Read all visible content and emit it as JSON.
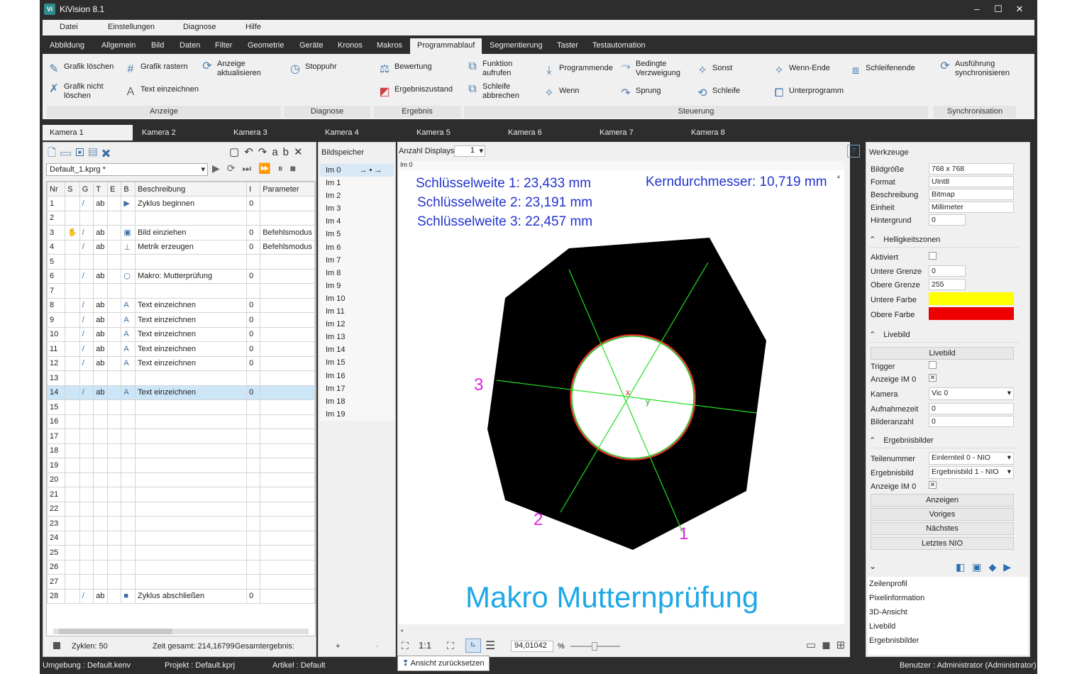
{
  "app": {
    "title": "KiVision  8.1",
    "logo": "Vi",
    "min": "–",
    "max": "☐",
    "close": "✕"
  },
  "menu": [
    "Datei",
    "Einstellungen",
    "Diagnose",
    "Hilfe"
  ],
  "tabs": [
    "Abbildung",
    "Allgemein",
    "Bild",
    "Daten",
    "Filter",
    "Geometrie",
    "Geräte",
    "Kronos",
    "Makros",
    "Programmablauf",
    "Segmentierung",
    "Taster",
    "Testautomation"
  ],
  "ribbon": {
    "anzeige": {
      "b1": "Grafik löschen",
      "b2": "Grafik rastern",
      "b3a": "Anzeige",
      "b3b": "aktualisieren",
      "b4a": "Grafik nicht",
      "b4b": "löschen",
      "b5": "Text einzeichnen",
      "label": "Anzeige"
    },
    "diagnose": {
      "b1": "Stoppuhr",
      "label": "Diagnose"
    },
    "ergebnis": {
      "b1": "Bewertung",
      "b2": "Ergebniszustand",
      "label": "Ergebnis"
    },
    "steuerung": {
      "f1a": "Funktion",
      "f1b": "aufrufen",
      "pe": "Programmende",
      "bv1": "Bedingte",
      "bv2": "Verzweigung",
      "sonst": "Sonst",
      "wenn_ende": "Wenn-Ende",
      "schleifenende": "Schleifenende",
      "sa1": "Schleife",
      "sa2": "abbrechen",
      "wenn": "Wenn",
      "sprung": "Sprung",
      "schleife": "Schleife",
      "up": "Unterprogramm",
      "label": "Steuerung"
    },
    "sync": {
      "a": "Ausführung",
      "b": "synchronisieren",
      "label": "Synchronisation"
    }
  },
  "cameras": [
    "Kamera 1",
    "Kamera 2",
    "Kamera 3",
    "Kamera 4",
    "Kamera 5",
    "Kamera 6",
    "Kamera 7",
    "Kamera 8"
  ],
  "program": {
    "file": "Default_1.kprg *",
    "headers": [
      "Nr",
      "S",
      "G",
      "T",
      "E",
      "B",
      "Beschreibung",
      "I",
      "Parameter"
    ],
    "rows": [
      {
        "nr": "1",
        "g": "/",
        "t": "ab",
        "b": "▶",
        "d": "Zyklus beginnen",
        "i": "0",
        "p": ""
      },
      {
        "nr": "2",
        "g": "",
        "t": "",
        "b": "",
        "d": "",
        "i": "",
        "p": ""
      },
      {
        "nr": "3",
        "s": "✋",
        "g": "/",
        "t": "ab",
        "b": "▣",
        "d": "Bild einziehen",
        "i": "0",
        "p": "Befehlsmodus"
      },
      {
        "nr": "4",
        "g": "/",
        "t": "ab",
        "b": "⊥",
        "d": "Metrik erzeugen",
        "i": "0",
        "p": "Befehlsmodus"
      },
      {
        "nr": "5",
        "g": "",
        "t": "",
        "b": "",
        "d": "",
        "i": "",
        "p": ""
      },
      {
        "nr": "6",
        "g": "/",
        "t": "ab",
        "b": "⬡",
        "d": "Makro: Mutterprüfung",
        "i": "0",
        "p": ""
      },
      {
        "nr": "7",
        "g": "",
        "t": "",
        "b": "",
        "d": "",
        "i": "",
        "p": ""
      },
      {
        "nr": "8",
        "g": "/",
        "t": "ab",
        "b": "A",
        "d": "Text einzeichnen",
        "i": "0",
        "p": ""
      },
      {
        "nr": "9",
        "g": "/",
        "t": "ab",
        "b": "A",
        "d": "Text einzeichnen",
        "i": "0",
        "p": ""
      },
      {
        "nr": "10",
        "g": "/",
        "t": "ab",
        "b": "A",
        "d": "Text einzeichnen",
        "i": "0",
        "p": ""
      },
      {
        "nr": "11",
        "g": "/",
        "t": "ab",
        "b": "A",
        "d": "Text einzeichnen",
        "i": "0",
        "p": ""
      },
      {
        "nr": "12",
        "g": "/",
        "t": "ab",
        "b": "A",
        "d": "Text einzeichnen",
        "i": "0",
        "p": ""
      },
      {
        "nr": "13",
        "g": "",
        "t": "",
        "b": "",
        "d": "",
        "i": "",
        "p": ""
      },
      {
        "nr": "14",
        "g": "/",
        "t": "ab",
        "b": "A",
        "d": "Text einzeichnen",
        "i": "0",
        "p": "",
        "sel": true
      },
      {
        "nr": "15"
      },
      {
        "nr": "16"
      },
      {
        "nr": "17"
      },
      {
        "nr": "18"
      },
      {
        "nr": "19"
      },
      {
        "nr": "20"
      },
      {
        "nr": "21"
      },
      {
        "nr": "22"
      },
      {
        "nr": "23"
      },
      {
        "nr": "24"
      },
      {
        "nr": "25"
      },
      {
        "nr": "26"
      },
      {
        "nr": "27"
      },
      {
        "nr": "28",
        "g": "/",
        "t": "ab",
        "b": "■",
        "d": "Zyklus abschließen",
        "i": "0",
        "p": ""
      }
    ],
    "zyklen": "Zyklen: 50",
    "zeit": "Zeit gesamt: 214,16799",
    "gesamt": "Gesamtergebnis:"
  },
  "bildspeicher": {
    "title": "Bildspeicher",
    "items": [
      "Im 0",
      "Im 1",
      "Im 2",
      "Im 3",
      "Im 4",
      "Im 5",
      "Im 6",
      "Im 7",
      "Im 8",
      "Im 9",
      "Im 10",
      "Im 11",
      "Im 12",
      "Im 13",
      "Im 14",
      "Im 15",
      "Im 16",
      "Im 17",
      "Im 18",
      "Im 19"
    ],
    "arrow": "→ • →",
    "plus": "+",
    "minus": "-"
  },
  "display": {
    "label": "Anzahl Displays",
    "count": "1",
    "im": "Im 0",
    "help": "?",
    "zoom": "94,01042",
    "pct": "%",
    "one": "1:1",
    "tooltip": "Ansicht zurücksetzen"
  },
  "overlay": {
    "s1": "Schlüsselweite 1: 23,433 mm",
    "s2": "Schlüsselweite 2: 23,191 mm",
    "s3": "Schlüsselweite 3: 22,457 mm",
    "kd": "Kerndurchmesser: 10,719 mm",
    "n1": "1",
    "n2": "2",
    "n3": "3",
    "ax": "x",
    "ay": "y",
    "macro": "Makro Mutternprüfung",
    "text_color": "#2233cc",
    "num_color": "#e020e0",
    "macro_color": "#1ea8e8"
  },
  "tools": {
    "title": "Werkzeuge",
    "bildgroesse": "Bildgröße",
    "bildgroesse_v": "768 x 768",
    "format": "Format",
    "format_v": "UInt8",
    "beschreibung": "Beschreibung",
    "beschreibung_v": "Bitmap",
    "einheit": "Einheit",
    "einheit_v": "Millimeter",
    "hintergrund": "Hintergrund",
    "hintergrund_v": "0",
    "hz": "Helligkeitszonen",
    "aktiviert": "Aktiviert",
    "untere": "Untere Grenze",
    "untere_v": "0",
    "obere": "Obere Grenze",
    "obere_v": "255",
    "uf": "Untere Farbe",
    "of": "Obere Farbe",
    "uf_c": "#ffff00",
    "of_c": "#ee0000",
    "livebild": "Livebild",
    "livebtn": "Livebild",
    "trigger": "Trigger",
    "anzeige": "Anzeige IM 0",
    "check": "✕",
    "kamera": "Kamera",
    "kamera_v": "Vic 0",
    "aufnahme": "Aufnahmezeit",
    "aufnahme_v": "0",
    "bilderanzahl": "Bilderanzahl",
    "bilderanzahl_v": "0",
    "eb": "Ergebnisbilder",
    "teil": "Teilenummer",
    "teil_v": "Einlernteil 0 - NIO",
    "ebild": "Ergebnisbild",
    "ebild_v": "Ergebnisbild 1 - NIO",
    "anz2": "Anzeige IM 0",
    "b_anzeigen": "Anzeigen",
    "b_voriges": "Voriges",
    "b_naechstes": "Nächstes",
    "b_letztes": "Letztes NIO",
    "list": [
      "Zeilenprofil",
      "Pixelinformation",
      "3D-Ansicht",
      "Livebild",
      "Ergebnisbilder"
    ]
  },
  "status": {
    "umgebung": "Umgebung :  Default.kenv",
    "projekt": "Projekt :  Default.kprj",
    "artikel": "Artikel :  Default",
    "benutzer": "Benutzer :  Administrator (Administrator)"
  }
}
